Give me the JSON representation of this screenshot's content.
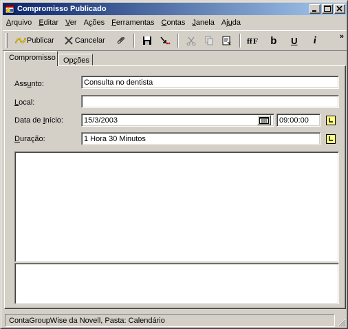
{
  "window": {
    "title": "Compromisso Publicado"
  },
  "menu": [
    {
      "pre": "",
      "key": "A",
      "post": "rquivo"
    },
    {
      "pre": "",
      "key": "E",
      "post": "ditar"
    },
    {
      "pre": "",
      "key": "V",
      "post": "er"
    },
    {
      "pre": "A",
      "key": "ç",
      "post": "ões"
    },
    {
      "pre": "",
      "key": "F",
      "post": "erramentas"
    },
    {
      "pre": "",
      "key": "C",
      "post": "ontas"
    },
    {
      "pre": "",
      "key": "J",
      "post": "anela"
    },
    {
      "pre": "Aj",
      "key": "u",
      "post": "da"
    }
  ],
  "toolbar": {
    "publish_label": "Publicar",
    "cancel_label": "Cancelar",
    "bold_glyph": "b",
    "underline_glyph": "U",
    "italic_glyph": "i",
    "chevron": "»"
  },
  "tabs": [
    {
      "label": "Compromisso",
      "active": true
    },
    {
      "pre": "Op",
      "key": "ç",
      "post": "ões",
      "active": false
    }
  ],
  "form": {
    "subject_label_pre": "Ass",
    "subject_label_key": "u",
    "subject_label_post": "nto:",
    "subject_value": "Consulta no dentista",
    "location_label_pre": "",
    "location_label_key": "L",
    "location_label_post": "ocal:",
    "location_value": "",
    "start_label_pre": "Data de ",
    "start_label_key": "I",
    "start_label_post": "nício:",
    "start_date": "15/3/2003",
    "start_time": "09:00:00",
    "duration_label_pre": "",
    "duration_label_key": "D",
    "duration_label_post": "uração:",
    "duration_value": "1 Hora 30 Minutos"
  },
  "status": {
    "text": "ContaGroupWise da Novell,  Pasta: Calendário"
  },
  "colors": {
    "titlebar_start": "#0a246a",
    "titlebar_end": "#a6caf0",
    "face": "#d4d0c8"
  }
}
